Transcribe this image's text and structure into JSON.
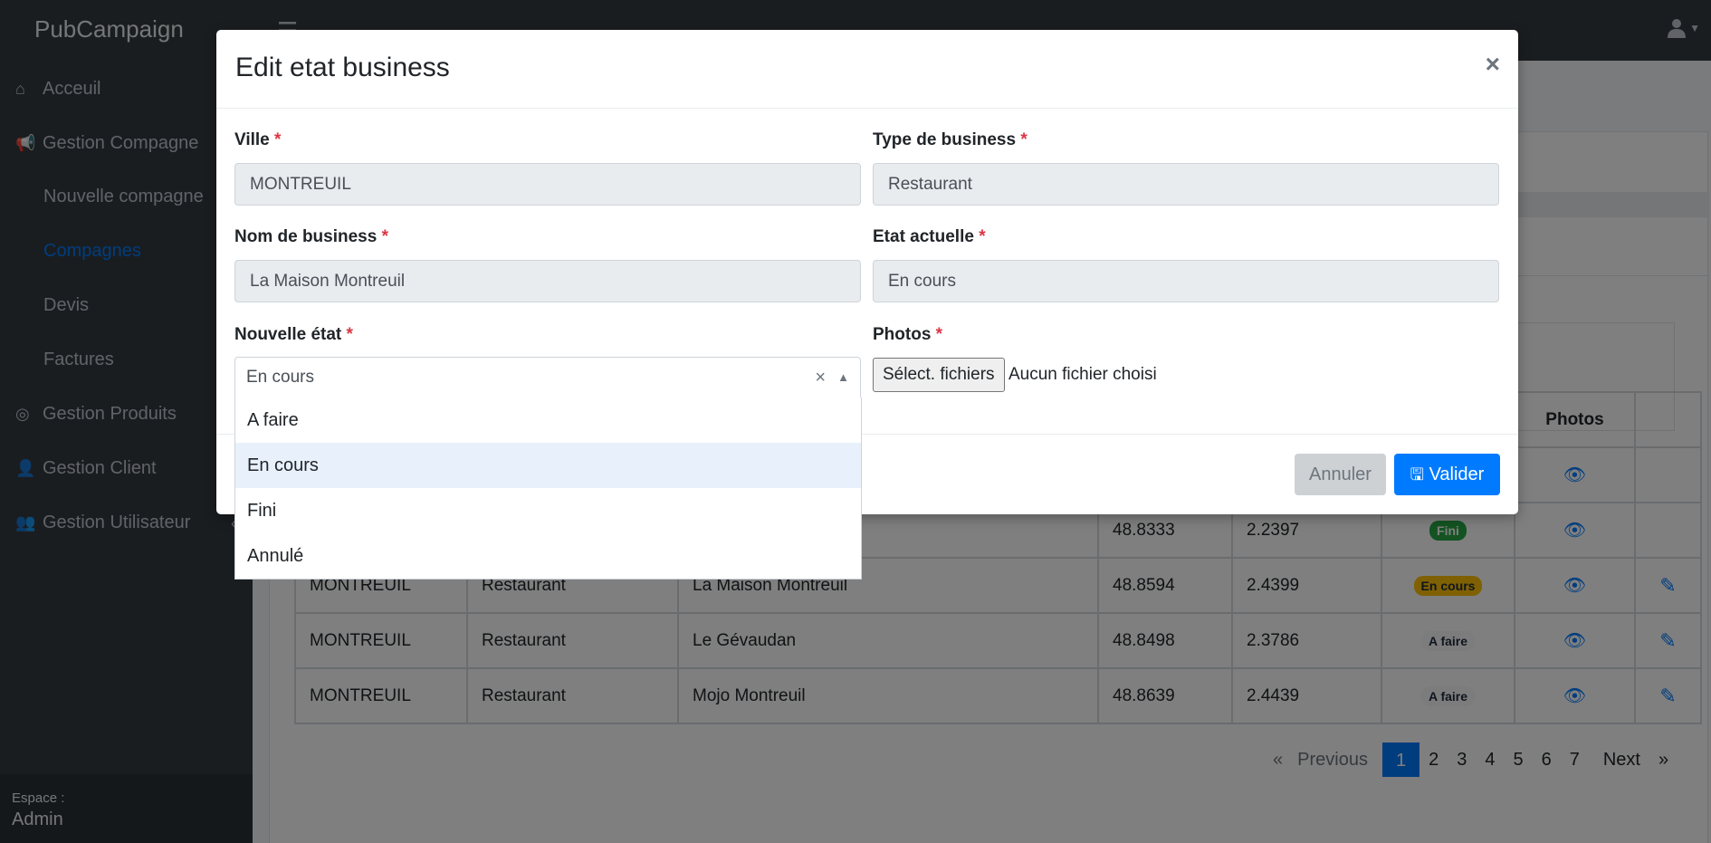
{
  "navbar": {
    "brand": "PubCampaign"
  },
  "sidebar": {
    "items": [
      {
        "label": "Acceuil",
        "icon": "home-icon"
      },
      {
        "label": "Gestion Compagne",
        "icon": "bullhorn-icon"
      },
      {
        "label": "Nouvelle compagne"
      },
      {
        "label": "Compagnes",
        "active": true
      },
      {
        "label": "Devis"
      },
      {
        "label": "Factures"
      },
      {
        "label": "Gestion Produits",
        "icon": "circle-icon"
      },
      {
        "label": "Gestion Client",
        "icon": "user-icon"
      },
      {
        "label": "Gestion Utilisateur",
        "icon": "users-icon"
      }
    ],
    "footer": {
      "label": "Espace :",
      "value": "Admin"
    }
  },
  "table": {
    "header_photos": "Photos",
    "rows": [
      {
        "ville": "",
        "type": "",
        "nom": "",
        "lat": "",
        "lng": "",
        "etat": "",
        "badge": ""
      },
      {
        "ville": "",
        "type": "",
        "nom": "",
        "lat": "48.8333",
        "lng": "2.2397",
        "etat": "Fini",
        "badge": "success"
      },
      {
        "ville": "MONTREUIL",
        "type": "Restaurant",
        "nom": "La Maison Montreuil",
        "lat": "48.8594",
        "lng": "2.4399",
        "etat": "En cours",
        "badge": "warning"
      },
      {
        "ville": "MONTREUIL",
        "type": "Restaurant",
        "nom": "Le Gévaudan",
        "lat": "48.8498",
        "lng": "2.3786",
        "etat": "A faire",
        "badge": "light"
      },
      {
        "ville": "MONTREUIL",
        "type": "Restaurant",
        "nom": "Mojo Montreuil",
        "lat": "48.8639",
        "lng": "2.4439",
        "etat": "A faire",
        "badge": "light"
      }
    ]
  },
  "pagination": {
    "previous": "Previous",
    "next": "Next",
    "prev_arrow": "«",
    "next_arrow": "»",
    "pages": [
      "1",
      "2",
      "3",
      "4",
      "5",
      "6",
      "7"
    ],
    "active_page": "1"
  },
  "modal": {
    "title": "Edit etat business",
    "close": "×",
    "required_mark": "*",
    "fields": {
      "ville": {
        "label": "Ville",
        "value": "MONTREUIL"
      },
      "type": {
        "label": "Type de business",
        "value": "Restaurant"
      },
      "nom": {
        "label": "Nom de business",
        "value": "La Maison Montreuil"
      },
      "etat_actuelle": {
        "label": "Etat actuelle",
        "value": "En cours"
      },
      "nouvelle_etat": {
        "label": "Nouvelle état",
        "value": "En cours",
        "clear": "×",
        "arrow": "▲"
      },
      "photos": {
        "label": "Photos",
        "button": "Sélect. fichiers",
        "status": "Aucun fichier choisi"
      }
    },
    "dropdown_options": [
      "A faire",
      "En cours",
      "Fini",
      "Annulé"
    ],
    "highlighted_option": "En cours",
    "buttons": {
      "cancel": "Annuler",
      "validate": "Valider"
    }
  },
  "colors": {
    "primary": "#007bff",
    "sidebar_bg": "#343a40",
    "danger": "#dc3545"
  }
}
